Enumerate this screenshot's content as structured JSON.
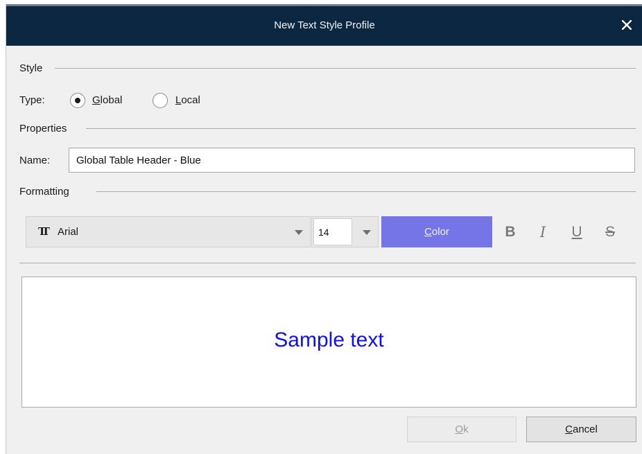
{
  "dialog": {
    "title": "New Text Style Profile",
    "close_glyph": "✕"
  },
  "style": {
    "section_label": "Style",
    "type_label": "Type:",
    "options": [
      {
        "access_key": "G",
        "rest": "lobal",
        "selected": true
      },
      {
        "access_key": "L",
        "rest": "ocal",
        "selected": false
      }
    ]
  },
  "properties": {
    "section_label": "Properties",
    "name_label": "Name:",
    "name_value": "Global Table Header - Blue"
  },
  "formatting": {
    "section_label": "Formatting",
    "font_icon": "font-type-icon",
    "font_value": "Arial",
    "size_value": "14",
    "color_button": {
      "access_key": "C",
      "rest": "olor"
    },
    "accent_color": "#7575e8",
    "bold_glyph": "B",
    "italic_glyph": "I",
    "underline_glyph": "U",
    "strike_glyph": "S"
  },
  "preview": {
    "sample_text": "Sample text",
    "sample_color": "#1010ee"
  },
  "buttons": {
    "ok": {
      "access_key": "O",
      "rest": "k",
      "enabled": false
    },
    "cancel": {
      "access_key": "C",
      "rest": "ancel"
    }
  }
}
